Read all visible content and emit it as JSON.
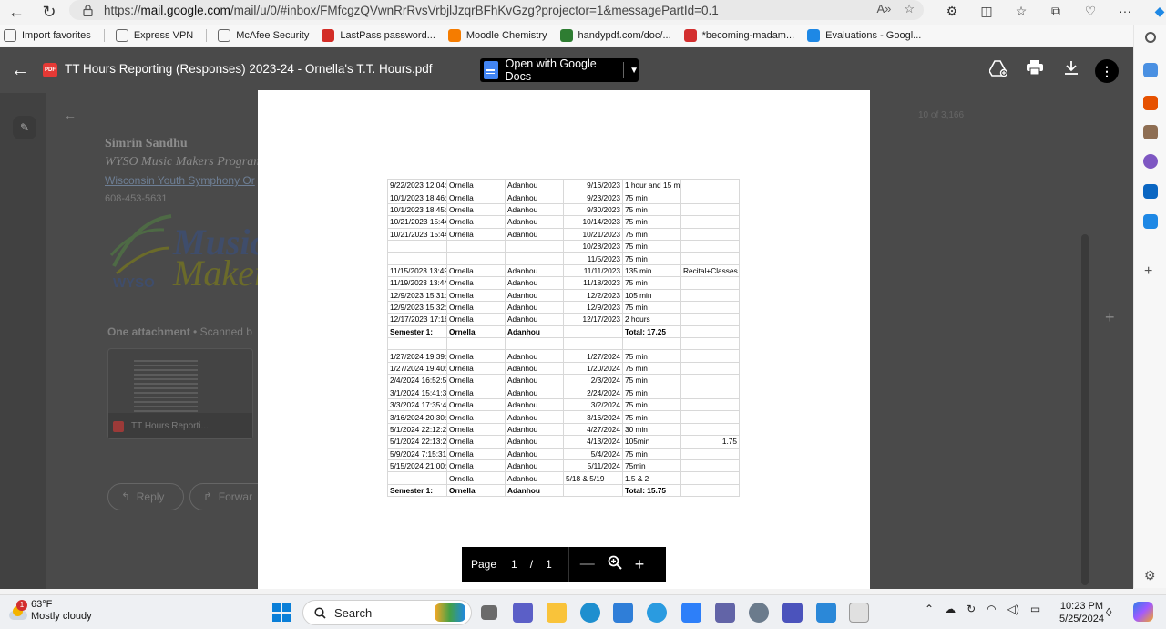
{
  "browser": {
    "url_prefix": "https://",
    "url_host": "mail.google.com",
    "url_path": "/mail/u/0/#inbox/FMfcgzQVwnRrRvsVrbjlJzqrBFhKvGzg?projector=1&messagePartId=0.1"
  },
  "favorites": [
    {
      "label": "Import favorites",
      "color": "#666666"
    },
    {
      "label": "Express VPN",
      "color": "#666666"
    },
    {
      "label": "McAfee Security",
      "color": "#666666"
    },
    {
      "label": "LastPass password...",
      "color": "#d32d27"
    },
    {
      "label": "Moodle Chemistry",
      "color": "#f57c00"
    },
    {
      "label": "handypdf.com/doc/...",
      "color": "#2e7d32"
    },
    {
      "label": "*becoming-madam...",
      "color": "#d32f2f"
    },
    {
      "label": "Evaluations - Googl...",
      "color": "#1e88e5"
    }
  ],
  "viewer": {
    "file_title": "TT Hours Reporting (Responses) 2023-24 - Ornella's T.T. Hours.pdf",
    "open_with": "Open with Google Docs"
  },
  "gmail_bg": {
    "sender_name": "Simrin Sandhu",
    "sender_line2": "WYSO Music Makers Program",
    "sender_link": "Wisconsin Youth Symphony Or",
    "phone": "608-453-5631",
    "logo_word1": "Music",
    "logo_word2": "Maker",
    "logo_brand": "WYSO",
    "attachment_header": "One attachment",
    "attachment_sub": "Scanned b",
    "attachment_name": "TT Hours Reporti...",
    "reply": "Reply",
    "forward": "Forwar",
    "count": "10 of 3,166"
  },
  "sheet_rows": [
    {
      "a": "9/22/2023 12:04:",
      "b": "Ornella",
      "c": "Adanhou",
      "d": "9/16/2023",
      "e": "1 hour and 15 min",
      "f": ""
    },
    {
      "a": "10/1/2023 18:46:",
      "b": "Ornella",
      "c": "Adanhou",
      "d": "9/23/2023",
      "e": "75 min",
      "f": ""
    },
    {
      "a": "10/1/2023 18:45:",
      "b": "Ornella",
      "c": "Adanhou",
      "d": "9/30/2023",
      "e": "75 min",
      "f": ""
    },
    {
      "a": "10/21/2023 15:44",
      "b": "Ornella",
      "c": "Adanhou",
      "d": "10/14/2023",
      "e": "75 min",
      "f": ""
    },
    {
      "a": "10/21/2023 15:44",
      "b": "Ornella",
      "c": "Adanhou",
      "d": "10/21/2023",
      "e": "75 min",
      "f": ""
    },
    {
      "a": "",
      "b": "",
      "c": "",
      "d": "10/28/2023",
      "e": "75 min",
      "f": ""
    },
    {
      "a": "",
      "b": "",
      "c": "",
      "d": "11/5/2023",
      "e": "75 min",
      "f": ""
    },
    {
      "a": "11/15/2023 13:49",
      "b": "Ornella",
      "c": "Adanhou",
      "d": "11/11/2023",
      "e": "135 min",
      "f": "Recital+Classes"
    },
    {
      "a": "11/19/2023 13:44",
      "b": "Ornella",
      "c": "Adanhou",
      "d": "11/18/2023",
      "e": "75 min",
      "f": ""
    },
    {
      "a": "12/9/2023 15:31:",
      "b": "Ornella",
      "c": "Adanhou",
      "d": "12/2/2023",
      "e": "105 min",
      "f": ""
    },
    {
      "a": "12/9/2023 15:32:",
      "b": "Ornella",
      "c": "Adanhou",
      "d": "12/9/2023",
      "e": "75 min",
      "f": ""
    },
    {
      "a": "12/17/2023 17:16",
      "b": "Ornella",
      "c": "Adanhou",
      "d": "12/17/2023",
      "e": "2 hours",
      "f": ""
    },
    {
      "a": "Semester 1:",
      "b": "Ornella",
      "c": "Adanhou",
      "d": "",
      "e": "Total: 17.25",
      "f": "",
      "bold": true
    },
    {
      "a": "",
      "b": "",
      "c": "",
      "d": "",
      "e": "",
      "f": ""
    },
    {
      "a": "1/27/2024 19:39:",
      "b": "Ornella",
      "c": "Adanhou",
      "d": "1/27/2024",
      "e": "75 min",
      "f": ""
    },
    {
      "a": "1/27/2024 19:40:",
      "b": "Ornella",
      "c": "Adanhou",
      "d": "1/20/2024",
      "e": "75 min",
      "f": ""
    },
    {
      "a": "2/4/2024 16:52:5",
      "b": "Ornella",
      "c": "Adanhou",
      "d": "2/3/2024",
      "e": "75 min",
      "f": ""
    },
    {
      "a": "3/1/2024 15:41:3",
      "b": "Ornella",
      "c": "Adanhou",
      "d": "2/24/2024",
      "e": "75 min",
      "f": ""
    },
    {
      "a": "3/3/2024 17:35:4",
      "b": "Ornella",
      "c": "Adanhou",
      "d": "3/2/2024",
      "e": "75 min",
      "f": ""
    },
    {
      "a": "3/16/2024 20:30:",
      "b": "Ornella",
      "c": "Adanhou",
      "d": "3/16/2024",
      "e": "75 min",
      "f": ""
    },
    {
      "a": "5/1/2024 22:12:2",
      "b": "Ornella",
      "c": "Adanhou",
      "d": "4/27/2024",
      "e": "30 min",
      "f": ""
    },
    {
      "a": "5/1/2024 22:13:2",
      "b": "Ornella",
      "c": "Adanhou",
      "d": "4/13/2024",
      "e": "105min",
      "f": "1.75",
      "f_right": true
    },
    {
      "a": "5/9/2024 7:15:31",
      "b": "Ornella",
      "c": "Adanhou",
      "d": "5/4/2024",
      "e": "75 min",
      "f": ""
    },
    {
      "a": "5/15/2024 21:00:",
      "b": "Ornella",
      "c": "Adanhou",
      "d": "5/11/2024",
      "e": "75min",
      "f": ""
    },
    {
      "a": "",
      "b": "Ornella",
      "c": "Adanhou",
      "d": "5/18 & 5/19",
      "d_left": true,
      "e": "1.5 & 2",
      "f": ""
    },
    {
      "a": "Semester 1:",
      "b": "Ornella",
      "c": "Adanhou",
      "d": "",
      "e": "Total: 15.75",
      "f": "",
      "bold": true
    }
  ],
  "page_control": {
    "label": "Page",
    "current": "1",
    "sep": "/",
    "total": "1"
  },
  "taskbar": {
    "temp": "63°F",
    "condition": "Mostly cloudy",
    "badge": "1",
    "search": "Search",
    "time": "10:23 PM",
    "date": "5/25/2024"
  }
}
